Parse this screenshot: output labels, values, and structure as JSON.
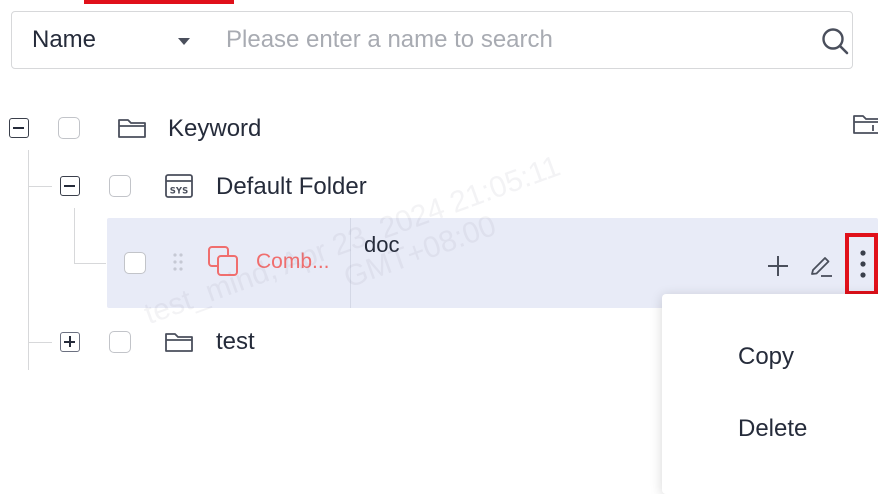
{
  "search": {
    "field_label": "Name",
    "placeholder": "Please enter a name to search",
    "value": ""
  },
  "tree": {
    "nodes": [
      {
        "label": "Keyword",
        "state": "expanded",
        "icon": "folder-icon"
      },
      {
        "label": "Default Folder",
        "state": "expanded",
        "icon": "system-folder-icon",
        "icon_text": "SYS"
      },
      {
        "label": "Comb...",
        "icon": "combination-icon",
        "description": "doc",
        "selected": true
      },
      {
        "label": "test",
        "state": "collapsed",
        "icon": "folder-icon"
      }
    ]
  },
  "context_menu": {
    "items": [
      "Copy",
      "Delete"
    ]
  },
  "watermark": {
    "line1": "test_mind, Apr 23, 2024 21:05:11",
    "line2": "GMT+08:00"
  },
  "colors": {
    "accent_red": "#e0101a",
    "selected_row_bg": "#e8ebf7",
    "combination_pink": "#f06e6e",
    "text_primary": "#252b3a",
    "placeholder": "#a8abb2"
  }
}
